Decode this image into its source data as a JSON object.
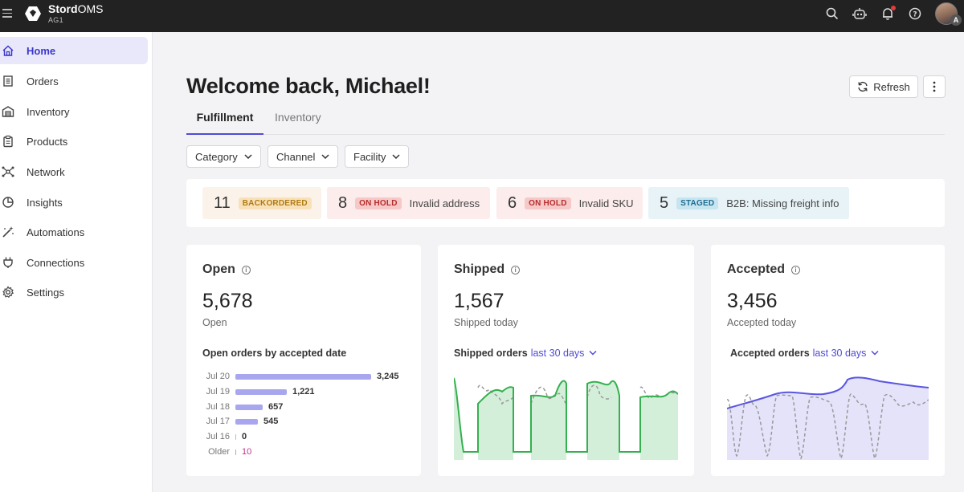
{
  "topbar": {
    "brand_bold": "Stord",
    "brand_light": "OMS",
    "org": "AG1",
    "avatar_badge": "A",
    "icons": [
      "menu-icon",
      "search-icon",
      "robot-icon",
      "bell-icon",
      "help-icon"
    ]
  },
  "sidebar": {
    "items": [
      {
        "label": "Home",
        "icon": "home-icon",
        "active": true
      },
      {
        "label": "Orders",
        "icon": "receipt-icon"
      },
      {
        "label": "Inventory",
        "icon": "warehouse-icon"
      },
      {
        "label": "Products",
        "icon": "clipboard-icon"
      },
      {
        "label": "Network",
        "icon": "network-icon"
      },
      {
        "label": "Insights",
        "icon": "pie-chart-icon"
      },
      {
        "label": "Automations",
        "icon": "wand-icon"
      },
      {
        "label": "Connections",
        "icon": "plug-icon"
      },
      {
        "label": "Settings",
        "icon": "gear-icon"
      }
    ]
  },
  "header": {
    "title": "Welcome back, Michael!",
    "refresh_label": "Refresh"
  },
  "tabs": [
    {
      "label": "Fulfillment",
      "active": true
    },
    {
      "label": "Inventory"
    }
  ],
  "filters": [
    "Category",
    "Channel",
    "Facility"
  ],
  "alerts": [
    {
      "count": "11",
      "pill": "BACKORDERED",
      "text": "",
      "bg": "#fbf3ea",
      "pill_bg": "#f8e1b8",
      "pill_color": "#b07a14"
    },
    {
      "count": "8",
      "pill": "ON HOLD",
      "text": "Invalid address",
      "bg": "#fcecec",
      "pill_bg": "#f6c9c9",
      "pill_color": "#b72b2b"
    },
    {
      "count": "6",
      "pill": "ON HOLD",
      "text": "Invalid SKU",
      "bg": "#fcecec",
      "pill_bg": "#f6c9c9",
      "pill_color": "#b72b2b"
    },
    {
      "count": "5",
      "pill": "STAGED",
      "text": "B2B: Missing freight info",
      "bg": "#e8f3f8",
      "pill_bg": "#c7e4f1",
      "pill_color": "#1d6d90"
    }
  ],
  "cards": {
    "open": {
      "title": "Open",
      "value": "5,678",
      "sub": "Open",
      "chart_title": "Open orders by accepted date",
      "bars": [
        {
          "label": "Jul 20",
          "value": 3245,
          "display": "3,245"
        },
        {
          "label": "Jul 19",
          "value": 1221,
          "display": "1,221"
        },
        {
          "label": "Jul 18",
          "value": 657,
          "display": "657"
        },
        {
          "label": "Jul 17",
          "value": 545,
          "display": "545"
        },
        {
          "label": "Jul 16",
          "value": 0,
          "display": "0"
        },
        {
          "label": "Older",
          "value": 10,
          "display": "10",
          "highlight": true
        }
      ]
    },
    "shipped": {
      "title": "Shipped",
      "value": "1,567",
      "sub": "Shipped today",
      "chart_title": "Shipped orders",
      "range": "last 30 days",
      "color": "#35b04f",
      "fill": "#d4efd9"
    },
    "accepted": {
      "title": "Accepted",
      "value": "3,456",
      "sub": "Accepted today",
      "chart_title": "Accepted orders",
      "range": "last 30 days",
      "color": "#5a56e0",
      "fill": "#e4e3fa"
    }
  },
  "colors": {
    "accent": "#4f4bd6",
    "topbar": "#222222",
    "active_nav_bg": "#e9e8fb"
  }
}
